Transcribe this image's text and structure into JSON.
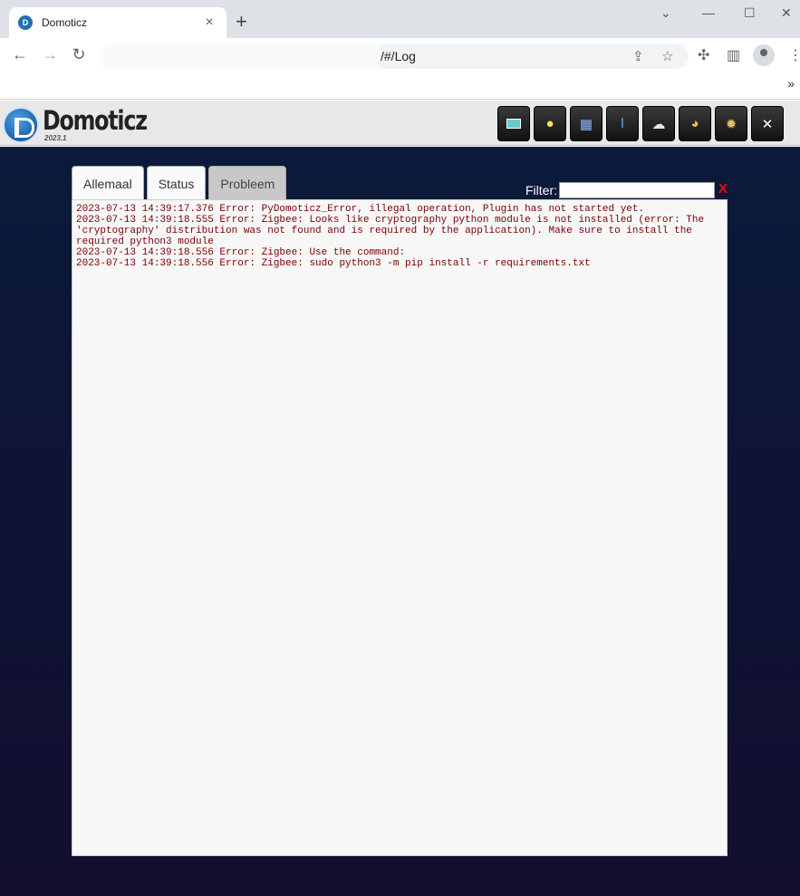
{
  "browser": {
    "tab_title": "Domoticz",
    "new_tab": "+",
    "url_path": "/#/Log",
    "icons": [
      "back-icon",
      "forward-icon",
      "reload-icon",
      "share-icon",
      "star-icon",
      "extensions-icon",
      "sidepanel-icon",
      "profile-icon",
      "menu-icon"
    ]
  },
  "app": {
    "logo_text": "Domoticz",
    "version": "2023.1",
    "nav_icons": [
      "dashboard-icon",
      "lightbulb-icon",
      "scenes-icon",
      "temperature-icon",
      "weather-icon",
      "utility-icon",
      "settings-icon",
      "tools-icon"
    ]
  },
  "log": {
    "tabs": [
      "Allemaal",
      "Status",
      "Probleem"
    ],
    "active_tab": "Probleem",
    "filter_label": "Filter:",
    "filter_value": "",
    "filter_clear": "X",
    "lines": [
      "2023-07-13 14:39:17.376 Error: PyDomoticz_Error, illegal operation, Plugin has not started yet.",
      "2023-07-13 14:39:18.555 Error: Zigbee: Looks like cryptography python module is not installed (error: The 'cryptography' distribution was not found and is required by the application). Make sure to install the required python3 module",
      "2023-07-13 14:39:18.556 Error: Zigbee: Use the command:",
      "2023-07-13 14:39:18.556 Error: Zigbee: sudo python3 -m pip install -r requirements.txt"
    ]
  }
}
